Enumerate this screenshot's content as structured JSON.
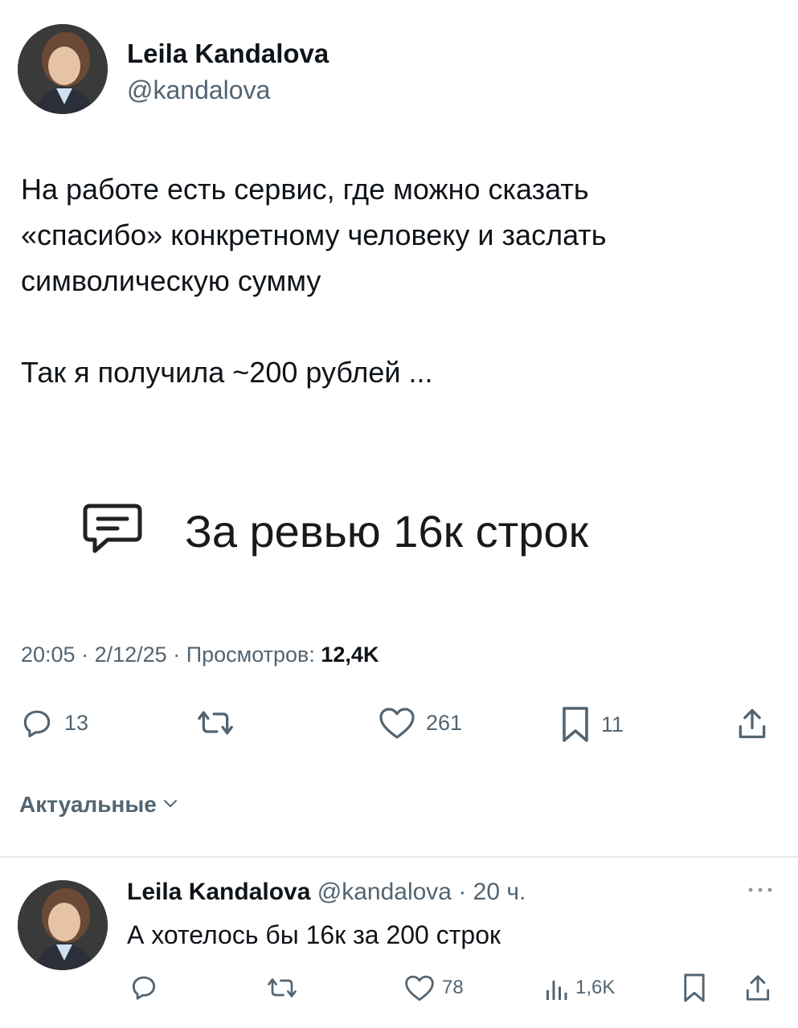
{
  "tweet": {
    "author_name": "Leila Kandalova",
    "author_handle": "@kandalova",
    "text_lines": [
      "На работе есть сервис, где можно сказать",
      "«спасибо» конкретному человеку и заслать",
      "символическую сумму",
      "Так я получила ~200 рублей ..."
    ],
    "embed_text": "За ревью 16к строк",
    "time": "20:05",
    "date": "2/12/25",
    "views_label": "Просмотров:",
    "views_count": "12,4K",
    "actions": {
      "replies": "13",
      "likes": "261",
      "bookmarks": "11"
    }
  },
  "sort_label": "Актуальные",
  "reply": {
    "author_name": "Leila Kandalova",
    "author_handle": "@kandalova",
    "age": "20 ч.",
    "text": "А хотелось бы 16к за 200 строк",
    "actions": {
      "likes": "78",
      "views": "1,6K"
    }
  },
  "colors": {
    "text": "#0f1419",
    "muted": "#536471",
    "divider": "#e6e9ec"
  }
}
